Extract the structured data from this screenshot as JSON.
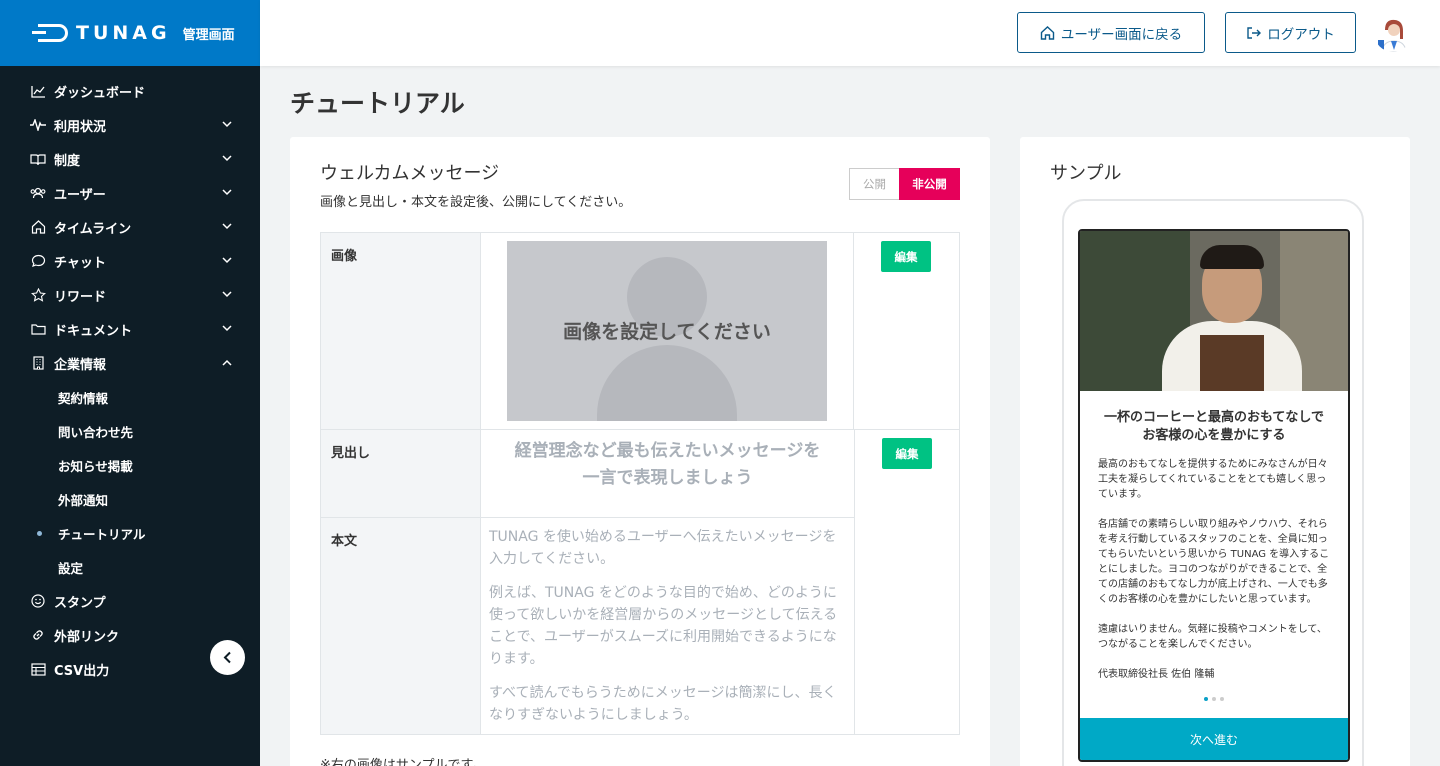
{
  "brand": {
    "name": "TUNAG",
    "subtitle": "管理画面",
    "color": "#0079c8"
  },
  "sidebar": {
    "items": [
      {
        "label": "ダッシュボード",
        "icon": "chart-line-icon",
        "expandable": false
      },
      {
        "label": "利用状況",
        "icon": "pulse-icon",
        "expandable": true
      },
      {
        "label": "制度",
        "icon": "book-icon",
        "expandable": true
      },
      {
        "label": "ユーザー",
        "icon": "users-icon",
        "expandable": true
      },
      {
        "label": "タイムライン",
        "icon": "home-icon",
        "expandable": true
      },
      {
        "label": "チャット",
        "icon": "chat-icon",
        "expandable": true
      },
      {
        "label": "リワード",
        "icon": "star-icon",
        "expandable": true
      },
      {
        "label": "ドキュメント",
        "icon": "folder-icon",
        "expandable": true
      },
      {
        "label": "企業情報",
        "icon": "building-icon",
        "expanded": true
      }
    ],
    "sub_items": [
      {
        "label": "契約情報"
      },
      {
        "label": "問い合わせ先"
      },
      {
        "label": "お知らせ掲載"
      },
      {
        "label": "外部通知"
      },
      {
        "label": "チュートリアル",
        "active": true
      },
      {
        "label": "設定"
      }
    ],
    "bottom_items": [
      {
        "label": "スタンプ",
        "icon": "smile-icon"
      },
      {
        "label": "外部リンク",
        "icon": "link-icon"
      },
      {
        "label": "CSV出力",
        "icon": "table-icon"
      }
    ]
  },
  "header": {
    "user_button": "ユーザー画面に戻る",
    "logout_button": "ログアウト"
  },
  "page": {
    "title": "チュートリアル"
  },
  "welcome": {
    "title": "ウェルカムメッセージ",
    "description": "画像と見出し・本文を設定後、公開にしてください。",
    "toggle_public": "公開",
    "toggle_private": "非公開",
    "label_image": "画像",
    "label_heading": "見出し",
    "label_body": "本文",
    "edit_label": "編集",
    "image_placeholder": "画像を設定してください",
    "heading_line1": "経営理念など最も伝えたいメッセージを",
    "heading_line2": "一言で表現しましょう",
    "body_p1": "TUNAG を使い始めるユーザーへ伝えたいメッセージを入力してください。",
    "body_p2": "例えば、TUNAG をどのような目的で始め、どのように使って欲しいかを経営層からのメッセージとして伝えることで、ユーザーがスムーズに利用開始できるようになります。",
    "body_p3": "すべて読んでもらうためにメッセージは簡潔にし、長くなりすぎないようにしましょう。",
    "note": "※右の画像はサンプルです。"
  },
  "sample": {
    "title": "サンプル",
    "heading_line1": "一杯のコーヒーと最高のおもてなしで",
    "heading_line2": "お客様の心を豊かにする",
    "body_p1": "最高のおもてなしを提供するためにみなさんが日々工夫を凝らしてくれていることをとても嬉しく思っています。",
    "body_p2": "各店舗での素晴らしい取り組みやノウハウ、それらを考え行動しているスタッフのことを、全員に知ってもらいたいという思いから TUNAG を導入することにしました。ヨコのつながりができることで、全ての店舗のおもてなし力が底上げされ、一人でも多くのお客様の心を豊かにしたいと思っています。",
    "body_p3": "遠慮はいりません。気軽に投稿やコメントをして、つながることを楽しんでください。",
    "signature": "代表取締役社長 佐伯 隆輔",
    "next_button": "次へ進む"
  },
  "colors": {
    "accent_private": "#e6005a",
    "edit_green": "#00c283",
    "next_teal": "#00a9c6"
  }
}
